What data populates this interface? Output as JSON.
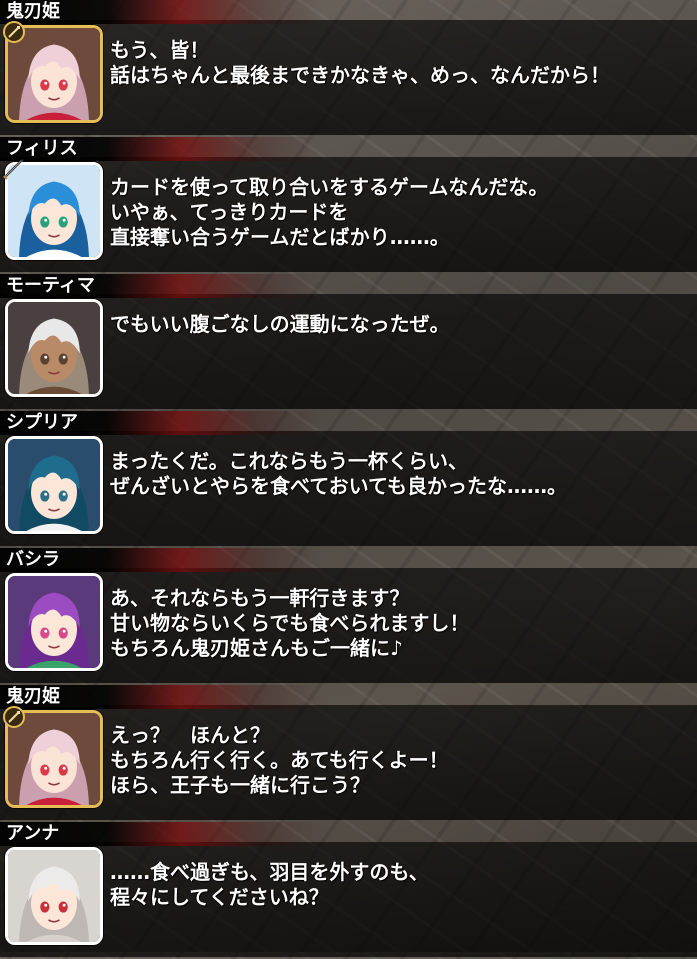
{
  "dialogue": [
    {
      "speaker": "鬼刃姫",
      "lines": [
        "もう、皆！",
        "話はちゃんと最後まできかなきゃ、めっ、なんだから！"
      ],
      "frame_color": "#e4bd55",
      "badge_icon": "sword-emblem-icon",
      "portrait": {
        "hair": "#f0d0d8",
        "hair_dark": "#caa0ae",
        "skin": "#fbe3d6",
        "eyes": "#d83a4a",
        "accent": "#c8203a",
        "bg": "#6e4a3c"
      }
    },
    {
      "speaker": "フィリス",
      "lines": [
        "カードを使って取り合いをするゲームなんだな。",
        "いやぁ、てっきりカードを",
        "直接奪い合うゲームだとばかり……。"
      ],
      "frame_color": "#ffffff",
      "badge_icon": "sword-icon",
      "portrait": {
        "hair": "#2a8fd8",
        "hair_dark": "#1a5f9e",
        "skin": "#fbe6d8",
        "eyes": "#2aa17a",
        "accent": "#ffffff",
        "bg": "#cfe4f4"
      }
    },
    {
      "speaker": "モーティマ",
      "lines": [
        "でもいい腹ごなしの運動になったぜ。"
      ],
      "frame_color": "#ffffff",
      "badge_icon": "",
      "portrait": {
        "hair": "#e8e8e8",
        "hair_dark": "#9a8a7a",
        "skin": "#b98a68",
        "eyes": "#5a4030",
        "accent": "#6a4b35",
        "bg": "#4a4040"
      }
    },
    {
      "speaker": "シプリア",
      "lines": [
        "まったくだ。これならもう一杯くらい、",
        "ぜんざいとやらを食べておいても良かったな……。"
      ],
      "frame_color": "#ffffff",
      "badge_icon": "",
      "portrait": {
        "hair": "#1f6d8c",
        "hair_dark": "#114a63",
        "skin": "#fbe6d8",
        "eyes": "#2c6f88",
        "accent": "#f2f2f2",
        "bg": "#2a4d6e"
      }
    },
    {
      "speaker": "バシラ",
      "lines": [
        "あ、それならもう一軒行きます？",
        "甘い物ならいくらでも食べられますし！",
        "もちろん鬼刃姫さんもご一緒に♪"
      ],
      "frame_color": "#ffffff",
      "badge_icon": "",
      "portrait": {
        "hair": "#9a4cc0",
        "hair_dark": "#6a2a90",
        "skin": "#fbe6d8",
        "eyes": "#d84a8a",
        "accent": "#3aa36a",
        "bg": "#5a3a7a"
      }
    },
    {
      "speaker": "鬼刃姫",
      "lines": [
        "えっ？　ほんと？",
        "もちろん行く行く。あても行くよー！",
        "ほら、王子も一緒に行こう？"
      ],
      "frame_color": "#e4bd55",
      "badge_icon": "sword-emblem-icon",
      "portrait": {
        "hair": "#f0d0d8",
        "hair_dark": "#caa0ae",
        "skin": "#fbe3d6",
        "eyes": "#d83a4a",
        "accent": "#c8203a",
        "bg": "#6e4a3c"
      }
    },
    {
      "speaker": "アンナ",
      "lines": [
        "……食べ過ぎも、羽目を外すのも、",
        "程々にしてくださいね？"
      ],
      "frame_color": "#ffffff",
      "badge_icon": "",
      "portrait": {
        "hair": "#ecebea",
        "hair_dark": "#bdb8b4",
        "skin": "#fbe6d8",
        "eyes": "#c8303a",
        "accent": "#d8d0cc",
        "bg": "#d8d4d0"
      }
    }
  ]
}
